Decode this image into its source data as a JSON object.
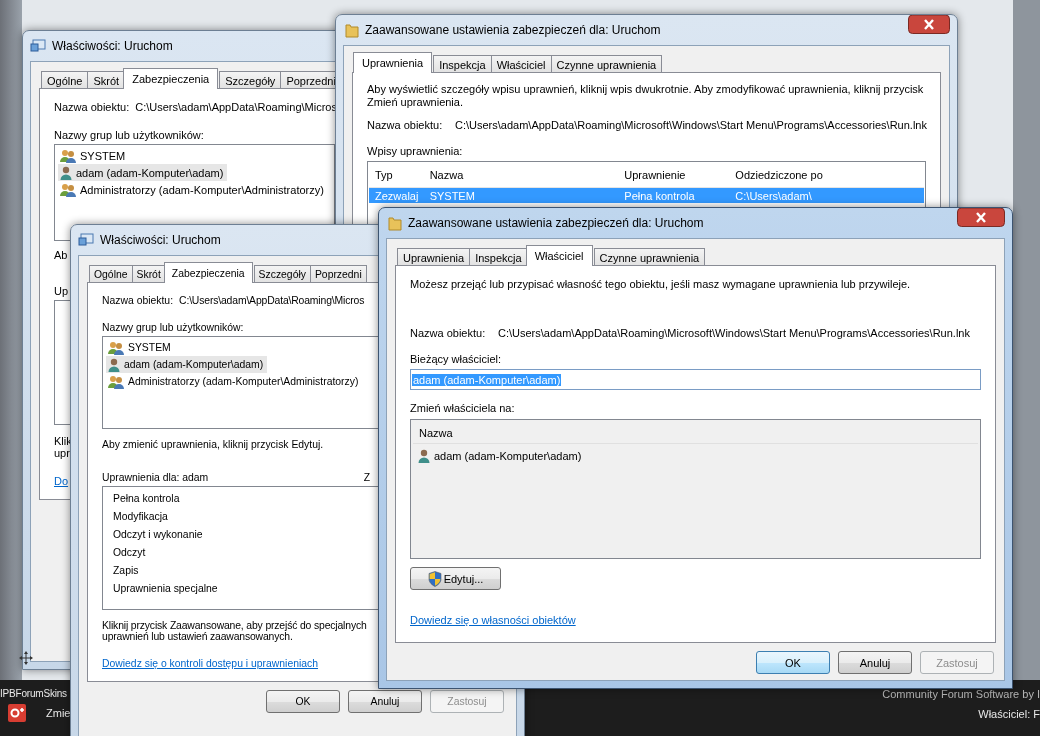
{
  "web_page": {
    "footer_title": "IPBForumSkins",
    "footer_link": "Zmie",
    "credit": "Community Forum Software by I",
    "owner": "Właściciel: F"
  },
  "properties_back": {
    "title": "Właściwości: Uruchom",
    "tabs": [
      {
        "label": "Ogólne",
        "selected": false
      },
      {
        "label": "Skrót",
        "selected": false
      },
      {
        "label": "Zabezpieczenia",
        "selected": true
      },
      {
        "label": "Szczegóły",
        "selected": false
      },
      {
        "label": "Poprzedni",
        "selected": false
      }
    ],
    "object_label": "Nazwa obiektu:",
    "object_path": "C:\\Users\\adam\\AppData\\Roaming\\Micros",
    "groups_label": "Nazwy grup lub użytkowników:",
    "groups": [
      {
        "name": "SYSTEM",
        "kind": "group",
        "selected": false
      },
      {
        "name": "adam (adam-Komputer\\adam)",
        "kind": "user",
        "selected": true
      },
      {
        "name": "Administratorzy (adam-Komputer\\Administratorzy)",
        "kind": "group",
        "selected": false
      }
    ],
    "edit_hint": "Ab",
    "permissions_label": "Up",
    "advanced_hint": [
      "Klik",
      "upr"
    ],
    "link": "Do"
  },
  "advanced_back": {
    "title": "Zaawansowane ustawienia zabezpieczeń dla: Uruchom",
    "tabs": [
      {
        "label": "Uprawnienia",
        "selected": true
      },
      {
        "label": "Inspekcja",
        "selected": false
      },
      {
        "label": "Właściciel",
        "selected": false
      },
      {
        "label": "Czynne uprawnienia",
        "selected": false
      }
    ],
    "description": "Aby wyświetlić szczegóły wpisu uprawnień, kliknij wpis dwukrotnie. Aby zmodyfikować uprawnienia, kliknij przycisk Zmień uprawnienia.",
    "object_label": "Nazwa obiektu:",
    "object_path": "C:\\Users\\adam\\AppData\\Roaming\\Microsoft\\Windows\\Start Menu\\Programs\\Accessories\\Run.lnk",
    "entries_label": "Wpisy uprawnienia:",
    "columns": [
      "Typ",
      "Nazwa",
      "Uprawnienie",
      "Odziedziczone po"
    ],
    "rows": [
      {
        "cells": [
          "Zezwalaj",
          "SYSTEM",
          "Pełna kontrola",
          "C:\\Users\\adam\\"
        ],
        "selected": true
      }
    ]
  },
  "properties_front": {
    "title": "Właściwości: Uruchom",
    "tabs": [
      {
        "label": "Ogólne",
        "selected": false
      },
      {
        "label": "Skrót",
        "selected": false
      },
      {
        "label": "Zabezpieczenia",
        "selected": true
      },
      {
        "label": "Szczegóły",
        "selected": false
      },
      {
        "label": "Poprzedni",
        "selected": false
      }
    ],
    "object_label": "Nazwa obiektu:",
    "object_path": "C:\\Users\\adam\\AppData\\Roaming\\Micros",
    "groups_label": "Nazwy grup lub użytkowników:",
    "groups": [
      {
        "name": "SYSTEM",
        "kind": "group",
        "selected": false
      },
      {
        "name": "adam (adam-Komputer\\adam)",
        "kind": "user",
        "selected": true
      },
      {
        "name": "Administratorzy (adam-Komputer\\Administratorzy)",
        "kind": "group",
        "selected": false
      }
    ],
    "edit_hint": "Aby zmienić uprawnienia, kliknij przycisk Edytuj.",
    "permissions_label": "Uprawnienia dla: adam",
    "permissions_column": "Z",
    "permissions": [
      "Pełna kontrola",
      "Modyfikacja",
      "Odczyt i wykonanie",
      "Odczyt",
      "Zapis",
      "Uprawnienia specjalne"
    ],
    "advanced_hint": [
      "Kliknij przycisk Zaawansowane, aby przejść do specjalnych",
      "uprawnień lub ustawień zaawansowanych."
    ],
    "link": "Dowiedz się o kontroli dostępu i uprawnieniach",
    "buttons": [
      {
        "label": "OK",
        "default": false,
        "disabled": false
      },
      {
        "label": "Anuluj",
        "default": false,
        "disabled": false
      },
      {
        "label": "Zastosuj",
        "default": false,
        "disabled": true
      }
    ]
  },
  "advanced_front": {
    "title": "Zaawansowane ustawienia zabezpieczeń dla: Uruchom",
    "tabs": [
      {
        "label": "Uprawnienia",
        "selected": false
      },
      {
        "label": "Inspekcja",
        "selected": false
      },
      {
        "label": "Właściciel",
        "selected": true
      },
      {
        "label": "Czynne uprawnienia",
        "selected": false
      }
    ],
    "description": "Możesz przejąć lub przypisać własność tego obiektu, jeśli masz wymagane uprawnienia lub przywileje.",
    "object_label": "Nazwa obiektu:",
    "object_path": "C:\\Users\\adam\\AppData\\Roaming\\Microsoft\\Windows\\Start Menu\\Programs\\Accessories\\Run.lnk",
    "current_owner_label": "Bieżący właściciel:",
    "current_owner_value": "adam (adam-Komputer\\adam)",
    "current_owner_highlighted": true,
    "change_label": "Zmień właściciela na:",
    "list_column": "Nazwa",
    "candidates": [
      {
        "name": "adam (adam-Komputer\\adam)",
        "kind": "user",
        "selected": false
      }
    ],
    "edit_button": "Edytuj...",
    "link": "Dowiedz się o własności obiektów",
    "buttons": [
      {
        "label": "OK",
        "default": true,
        "disabled": false
      },
      {
        "label": "Anuluj",
        "default": false,
        "disabled": false
      },
      {
        "label": "Zastosuj",
        "default": false,
        "disabled": true
      }
    ]
  }
}
